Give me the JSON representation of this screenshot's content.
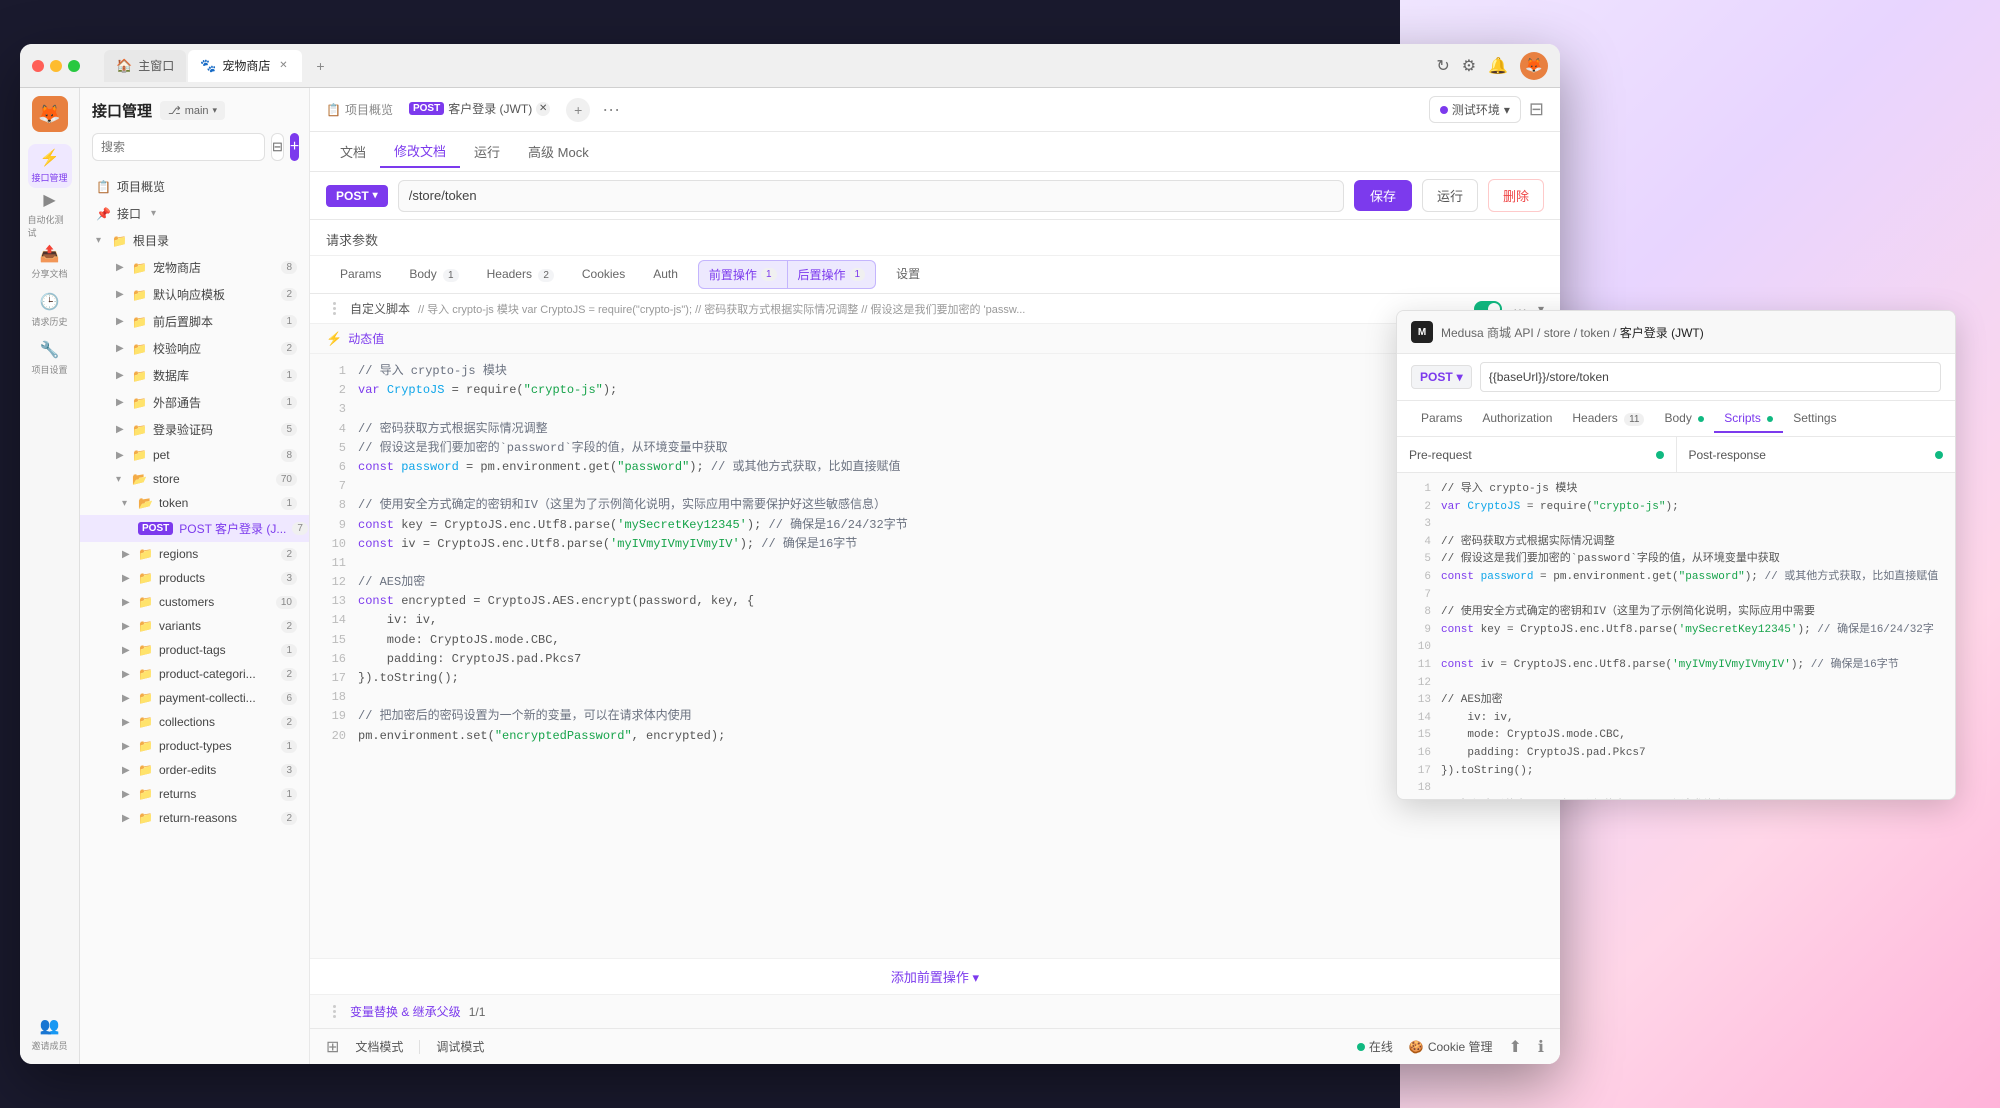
{
  "window": {
    "title": "宠物商店",
    "tabs": [
      {
        "label": "主窗口",
        "icon": "🏠",
        "active": false,
        "closable": false
      },
      {
        "label": "宠物商店",
        "icon": "🐾",
        "active": true,
        "closable": true
      }
    ]
  },
  "titlebar_actions": [
    "↻",
    "⚙",
    "🔔"
  ],
  "sidebar_icons": [
    {
      "name": "avatar",
      "label": ""
    },
    {
      "name": "api-management",
      "label": "接口管理",
      "active": true
    },
    {
      "name": "auto-test",
      "label": "自动化测试"
    },
    {
      "name": "share-doc",
      "label": "分享文档"
    },
    {
      "name": "request-history",
      "label": "请求历史"
    },
    {
      "name": "project-settings",
      "label": "项目设置"
    },
    {
      "name": "invite-members",
      "label": "邀请成员"
    }
  ],
  "nav": {
    "title": "接口管理",
    "branch": "main",
    "search_placeholder": "搜索",
    "add_btn": "+",
    "overview_label": "项目概览",
    "interface_label": "接口",
    "tree_items": [
      {
        "label": "根目录",
        "level": 0,
        "type": "folder",
        "expanded": true
      },
      {
        "label": "宠物商店",
        "level": 1,
        "type": "folder",
        "badge": "8"
      },
      {
        "label": "默认响应模板",
        "level": 1,
        "type": "folder",
        "badge": "2"
      },
      {
        "label": "前后置脚本",
        "level": 1,
        "type": "folder",
        "badge": "1"
      },
      {
        "label": "校验响应",
        "level": 1,
        "type": "folder",
        "badge": "2"
      },
      {
        "label": "数据库",
        "level": 1,
        "type": "folder",
        "badge": "1"
      },
      {
        "label": "外部通告",
        "level": 1,
        "type": "folder",
        "badge": "1"
      },
      {
        "label": "登录验证码",
        "level": 1,
        "type": "folder",
        "badge": "5"
      },
      {
        "label": "pet",
        "level": 1,
        "type": "folder",
        "badge": "8"
      },
      {
        "label": "store",
        "level": 1,
        "type": "folder",
        "badge": "70",
        "expanded": true
      },
      {
        "label": "token",
        "level": 2,
        "type": "folder",
        "badge": "1",
        "expanded": true
      },
      {
        "label": "POST 客户登录 (J...",
        "level": 3,
        "type": "file",
        "badge": "7",
        "method": "POST",
        "active": true
      },
      {
        "label": "regions",
        "level": 2,
        "type": "folder",
        "badge": "2"
      },
      {
        "label": "products",
        "level": 2,
        "type": "folder",
        "badge": "3"
      },
      {
        "label": "customers",
        "level": 2,
        "type": "folder",
        "badge": "10"
      },
      {
        "label": "variants",
        "level": 2,
        "type": "folder",
        "badge": "2"
      },
      {
        "label": "product-tags",
        "level": 2,
        "type": "folder",
        "badge": "1"
      },
      {
        "label": "product-categori...",
        "level": 2,
        "type": "folder",
        "badge": "2"
      },
      {
        "label": "payment-collecti...",
        "level": 2,
        "type": "folder",
        "badge": "6"
      },
      {
        "label": "collections",
        "level": 2,
        "type": "folder",
        "badge": "2"
      },
      {
        "label": "product-types",
        "level": 2,
        "type": "folder",
        "badge": "1"
      },
      {
        "label": "order-edits",
        "level": 2,
        "type": "folder",
        "badge": "3"
      },
      {
        "label": "returns",
        "level": 2,
        "type": "folder",
        "badge": "1"
      },
      {
        "label": "return-reasons",
        "level": 2,
        "type": "folder",
        "badge": "2"
      }
    ]
  },
  "api_editor": {
    "tab_bar_items": [
      {
        "label": "文档"
      },
      {
        "label": "修改文档",
        "active": true
      },
      {
        "label": "运行"
      },
      {
        "label": "高级 Mock"
      }
    ],
    "method": "POST",
    "url": "/store/token",
    "buttons": {
      "save": "保存",
      "run": "运行",
      "delete": "删除"
    },
    "section_header": "请求参数",
    "params_tabs": [
      {
        "label": "Params"
      },
      {
        "label": "Body",
        "count": "1"
      },
      {
        "label": "Headers",
        "count": "2"
      },
      {
        "label": "Cookies"
      },
      {
        "label": "Auth"
      },
      {
        "label": "前置操作",
        "count": "1",
        "active": true,
        "group": true
      },
      {
        "label": "后置操作",
        "count": "1",
        "group": true
      },
      {
        "label": "设置"
      }
    ],
    "script_label": "自定义脚本",
    "script_preview": "// 导入 crypto-js 模块 var CryptoJS = require(\"crypto-js\"); // 密码获取方式根据实际情况调整 // 假设这是我们要加密的 'passw...",
    "code_lines": [
      {
        "num": 1,
        "content": "// 导入 crypto-js 模块",
        "type": "comment"
      },
      {
        "num": 2,
        "content": "var CryptoJS = require(\"crypto-js\");",
        "type": "code"
      },
      {
        "num": 3,
        "content": "",
        "type": "blank"
      },
      {
        "num": 4,
        "content": "// 密码获取方式根据实际情况调整",
        "type": "comment"
      },
      {
        "num": 5,
        "content": "// 假设这是我们要加密的`password`字段的值，从环境变量中获取",
        "type": "comment"
      },
      {
        "num": 6,
        "content": "const password = pm.environment.get(\"password\"); // 或其他方式获取，比如直接赋值",
        "type": "code"
      },
      {
        "num": 7,
        "content": "",
        "type": "blank"
      },
      {
        "num": 8,
        "content": "// 使用安全方式确定的密钥和IV（这里为了示例简化说明，实际应用中需要保护好这些敏感信息）",
        "type": "comment"
      },
      {
        "num": 9,
        "content": "const key = CryptoJS.enc.Utf8.parse('mySecretKey12345'); // 确保是16/24/32字节",
        "type": "code"
      },
      {
        "num": 10,
        "content": "const iv = CryptoJS.enc.Utf8.parse('myIVmyIVmyIVmyIV'); // 确保是16字节",
        "type": "code"
      },
      {
        "num": 11,
        "content": "",
        "type": "blank"
      },
      {
        "num": 12,
        "content": "// AES加密",
        "type": "comment"
      },
      {
        "num": 13,
        "content": "const encrypted = CryptoJS.AES.encrypt(password, key, {",
        "type": "code"
      },
      {
        "num": 14,
        "content": "    iv: iv,",
        "type": "code"
      },
      {
        "num": 15,
        "content": "    mode: CryptoJS.mode.CBC,",
        "type": "code"
      },
      {
        "num": 16,
        "content": "    padding: CryptoJS.pad.Pkcs7",
        "type": "code"
      },
      {
        "num": 17,
        "content": "}).toString();",
        "type": "code"
      },
      {
        "num": 18,
        "content": "",
        "type": "blank"
      },
      {
        "num": 19,
        "content": "// 把加密后的密码设置为一个新的变量，可以在请求体内使用",
        "type": "comment"
      },
      {
        "num": 20,
        "content": "pm.environment.set(\"encryptedPassword\", encrypted);",
        "type": "code"
      }
    ],
    "dynamic_label": "动态值",
    "add_op_label": "添加前置操作 ▾",
    "vars_label": "变量替换 & 继承父级",
    "vars_count": "1/1",
    "footer": {
      "doc_mode": "文档模式",
      "debug_mode": "调试模式",
      "online": "在线",
      "cookie": "Cookie 管理"
    }
  },
  "right_panel": {
    "breadcrumb": "Medusa 商城 API / store / token / 客户登录 (JWT)",
    "method": "POST",
    "url": "{{baseUrl}}/store/token",
    "tabs": [
      {
        "label": "Params"
      },
      {
        "label": "Authorization"
      },
      {
        "label": "Headers",
        "count": "11"
      },
      {
        "label": "Body",
        "dot": true
      },
      {
        "label": "Scripts",
        "active": true,
        "dot": true
      },
      {
        "label": "Settings"
      }
    ],
    "scripts": [
      {
        "label": "Pre-request",
        "dot": true
      },
      {
        "label": "Post-response",
        "dot": true
      }
    ],
    "code_lines": [
      {
        "num": 1,
        "content": "// 导入 crypto-js 模块"
      },
      {
        "num": 2,
        "content": "var CryptoJS = require(\"crypto-js\");"
      },
      {
        "num": 3,
        "content": ""
      },
      {
        "num": 4,
        "content": "// 密码获取方式根据实际情况调整"
      },
      {
        "num": 5,
        "content": "// 假设这是我们要加密的`password`字段的值，从环境变量中获取"
      },
      {
        "num": 6,
        "content": "const password = pm.environment.get(\"password\"); // 或其他方式获取，比如直接赋值"
      },
      {
        "num": 7,
        "content": ""
      },
      {
        "num": 8,
        "content": "// 使用安全方式确定的密钥和IV（这里为了示例简化说明，实际应用中需要"
      },
      {
        "num": 9,
        "content": "const key = CryptoJS.enc.Utf8.parse('mySecretKey12345'); // 确保是16/24/32字"
      },
      {
        "num": 10,
        "content": ""
      },
      {
        "num": 11,
        "content": "const iv = CryptoJS.enc.Utf8.parse('myIVmyIVmyIVmyIV'); // 确保是16字节"
      },
      {
        "num": 12,
        "content": ""
      },
      {
        "num": 13,
        "content": "// AES加密"
      },
      {
        "num": 14,
        "content": "    iv: iv,"
      },
      {
        "num": 15,
        "content": "    mode: CryptoJS.mode.CBC,"
      },
      {
        "num": 16,
        "content": "    padding: CryptoJS.pad.Pkcs7"
      },
      {
        "num": 17,
        "content": "}).toString();"
      },
      {
        "num": 18,
        "content": ""
      },
      {
        "num": 19,
        "content": "// 把加密后的密码设置为一个新的变量，可以在请求体内使用"
      },
      {
        "num": 20,
        "content": "pm.environment.set(\"encryptedPassword\", encrypted);"
      }
    ]
  },
  "env_bar": {
    "label": "测试环境",
    "icon": "▼"
  },
  "colors": {
    "primary": "#7c3aed",
    "green": "#10b981",
    "red": "#ef4444",
    "bg": "#fafafa"
  }
}
